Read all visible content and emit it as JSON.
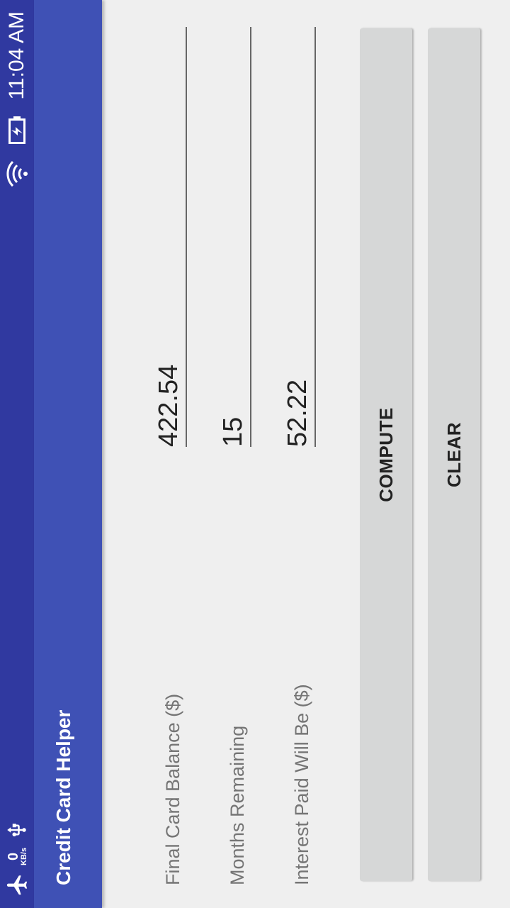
{
  "status_bar": {
    "speed_value": "0",
    "speed_unit": "KB/s",
    "time": "11:04 AM",
    "icons": [
      "airplane-icon",
      "usb-icon",
      "wifi-icon",
      "battery-charging-icon"
    ]
  },
  "app_bar": {
    "title": "Credit Card Helper"
  },
  "form": {
    "balance": {
      "label": "Final Card Balance ($)",
      "value": "422.54"
    },
    "months": {
      "label": "Months Remaining",
      "value": "15"
    },
    "interest": {
      "label": "Interest Paid Will Be ($)",
      "value": "52.22"
    }
  },
  "buttons": {
    "compute": "COMPUTE",
    "clear": "CLEAR"
  },
  "colors": {
    "status_bar": "#3039a0",
    "app_bar": "#3f51b5",
    "background": "#efefef",
    "button": "#d6d7d7"
  }
}
